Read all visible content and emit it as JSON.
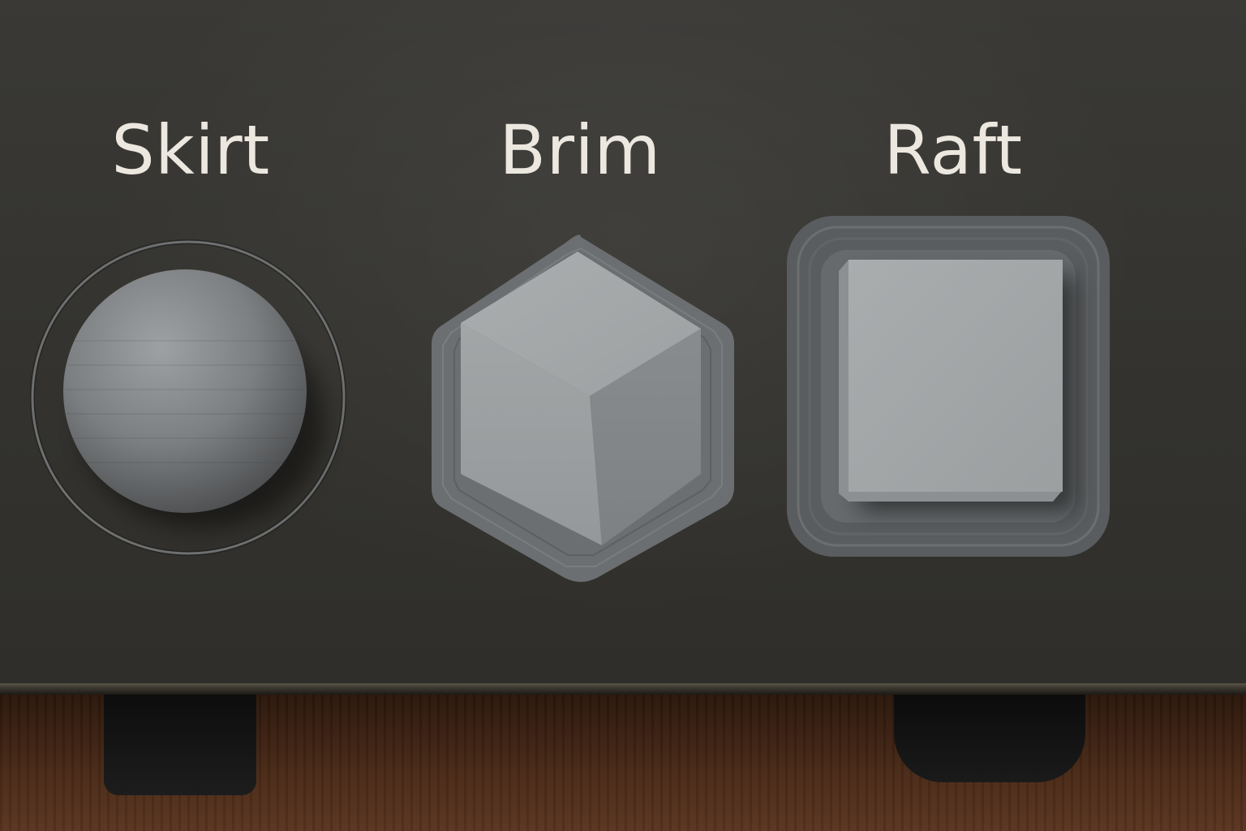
{
  "labels": {
    "skirt": "Skirt",
    "brim": "Brim",
    "raft": "Raft"
  },
  "colors": {
    "panel": "#34332f",
    "text": "#ece7df",
    "plastic_gray": "#9a9e9f",
    "table_wood": "#4a2a17"
  }
}
